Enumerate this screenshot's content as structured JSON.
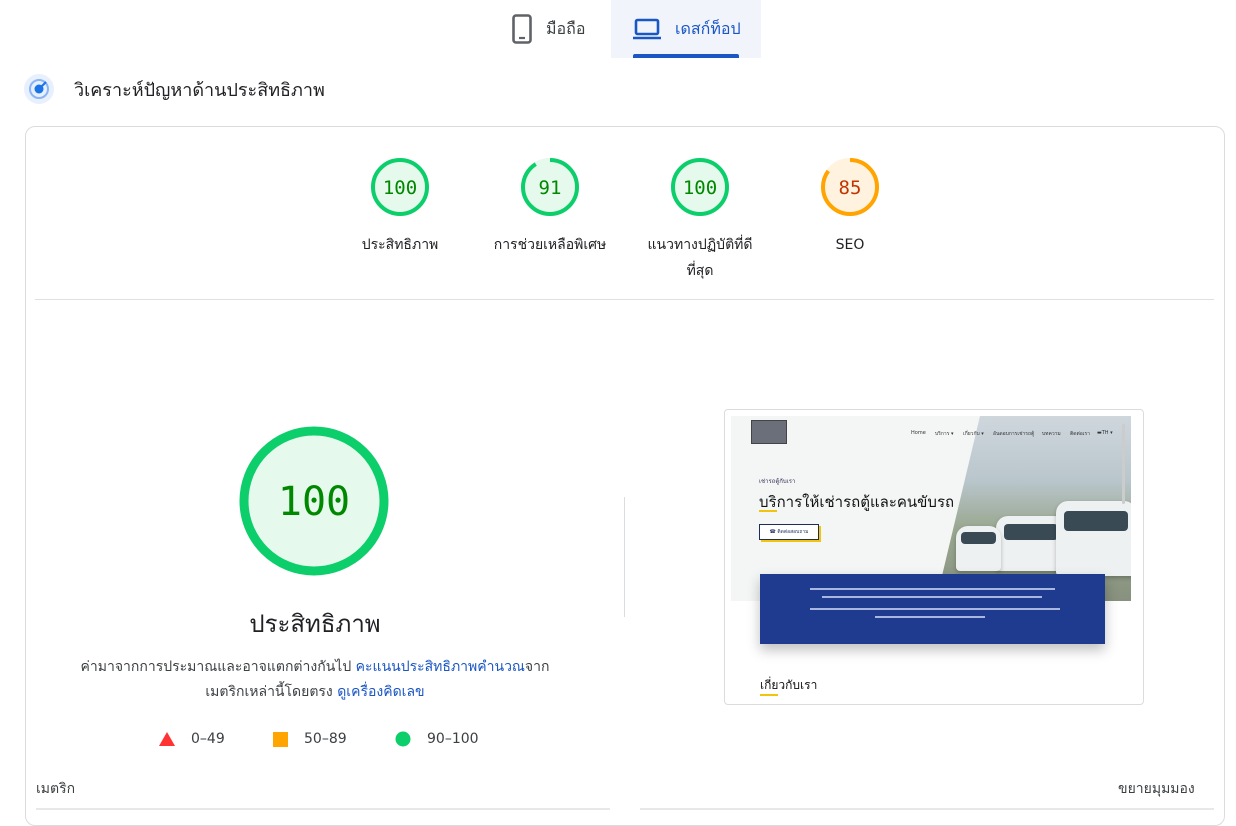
{
  "tabs": {
    "mobile_label": "มือถือ",
    "desktop_label": "เดสก์ท็อป",
    "active": "desktop"
  },
  "section": {
    "title": "วิเคราะห์ปัญหาด้านประสิทธิภาพ"
  },
  "scores": [
    {
      "id": "performance",
      "value": 100,
      "label": "ประสิทธิภาพ",
      "rating": "pass",
      "color": "#0cce6b",
      "text_color": "#008800",
      "bg": "#e6f9ed"
    },
    {
      "id": "accessibility",
      "value": 91,
      "label": "การช่วยเหลือพิเศษ",
      "rating": "pass",
      "color": "#0cce6b",
      "text_color": "#008800",
      "bg": "#e6f9ed"
    },
    {
      "id": "best-practices",
      "value": 100,
      "label": "แนวทางปฏิบัติที่ดีที่สุด",
      "rating": "pass",
      "color": "#0cce6b",
      "text_color": "#008800",
      "bg": "#e6f9ed"
    },
    {
      "id": "seo",
      "value": 85,
      "label": "SEO",
      "rating": "average",
      "color": "#ffa400",
      "text_color": "#c33300",
      "bg": "#fff3e0"
    }
  ],
  "main_score": {
    "value": 100,
    "title": "ประสิทธิภาพ"
  },
  "description": {
    "prefix": "ค่ามาจากการประมาณและอาจแตกต่างกันไป ",
    "link1": "คะแนนประสิทธิภาพคำนวณ",
    "middle": "จากเมตริกเหล่านี้โดยตรง ",
    "link2": "ดูเครื่องคิดเลข"
  },
  "legend": [
    {
      "range": "0–49",
      "shape": "triangle",
      "color": "#ff3333"
    },
    {
      "range": "50–89",
      "shape": "square",
      "color": "#ffa400"
    },
    {
      "range": "90–100",
      "shape": "circle",
      "color": "#0cce6b"
    }
  ],
  "preview": {
    "nav_items": [
      "Home",
      "บริการ ▾",
      "เกี่ยวกับ ▾",
      "อันดอบการเช่ารถตู้",
      "บทความ",
      "ติดต่อเรา",
      "▬TH ▾"
    ],
    "small_label": "เช่ารถตู้กับเรา",
    "headline": "บริการให้เช่ารถตู้และคนขับรถ",
    "button_label": "☎ ติดต่อสอบถาม",
    "about_heading": "เกี่ยวกับเรา"
  },
  "footer": {
    "metrics_label": "เมตริก",
    "expand_label": "ขยายมุมมอง"
  }
}
